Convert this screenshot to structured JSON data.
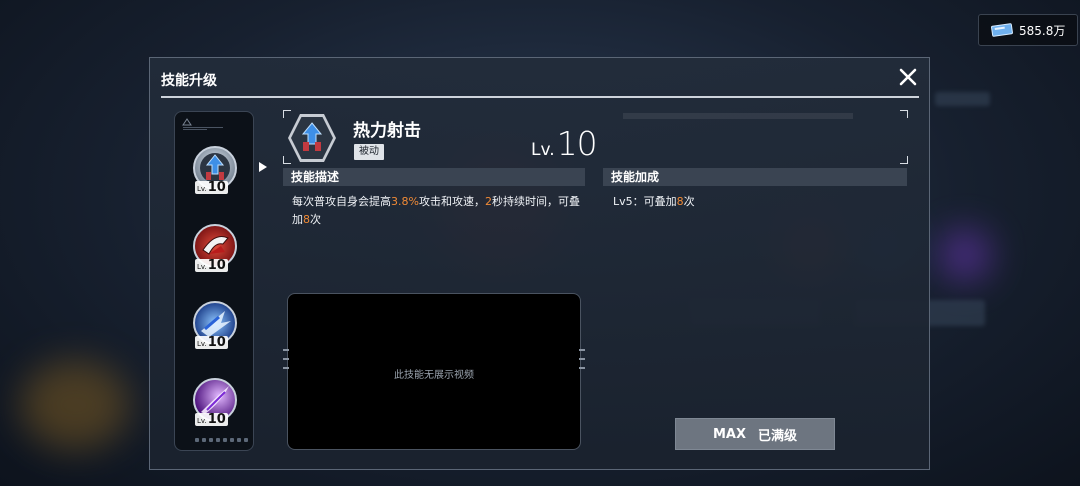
{
  "currency": {
    "amount": "585.8万",
    "icon": "ticket-icon"
  },
  "dialog": {
    "title": "技能升级",
    "close_icon": "close-icon"
  },
  "skill_list": {
    "items": [
      {
        "icon": "thermal-shot-skill-icon",
        "lv_label": "Lv.",
        "level": "10",
        "selected": true
      },
      {
        "icon": "red-claw-skill-icon",
        "lv_label": "Lv.",
        "level": "10",
        "selected": false
      },
      {
        "icon": "blue-burst-skill-icon",
        "lv_label": "Lv.",
        "level": "10",
        "selected": false
      },
      {
        "icon": "purple-slash-skill-icon",
        "lv_label": "Lv.",
        "level": "10",
        "selected": false
      }
    ]
  },
  "skill": {
    "name": "热力射击",
    "type": "被动",
    "lv_label": "Lv.",
    "level": "10"
  },
  "description": {
    "header": "技能描述",
    "parts": [
      "每次普攻自身会提高",
      "3.8%",
      "攻击和攻速，",
      "2",
      "秒持续时间，可叠加",
      "8",
      "次"
    ]
  },
  "bonus": {
    "header": "技能加成",
    "parts": [
      "Lv5：可叠加",
      "8",
      "次"
    ]
  },
  "video": {
    "message": "此技能无展示视频"
  },
  "max_button": {
    "prefix": "MAX",
    "label": "已满级"
  },
  "colors": {
    "highlight": "#f08a36",
    "panel": "#222c3a",
    "section": "#3a4452"
  }
}
